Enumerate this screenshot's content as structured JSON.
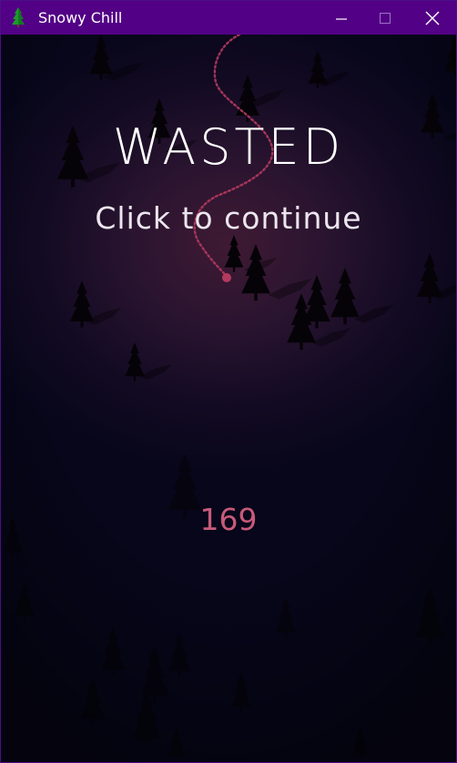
{
  "window": {
    "title": "Snowy Chill",
    "app_icon": "pine-tree-icon",
    "controls": [
      "minimize-icon",
      "maximize-icon",
      "close-icon"
    ],
    "titlebar_color": "#520085"
  },
  "game": {
    "headline": "WASTED",
    "prompt": "Click to continue",
    "score": "169",
    "colors": {
      "trail": "#b33a5e",
      "score": "#c85a7a",
      "tree": "#050307"
    }
  }
}
